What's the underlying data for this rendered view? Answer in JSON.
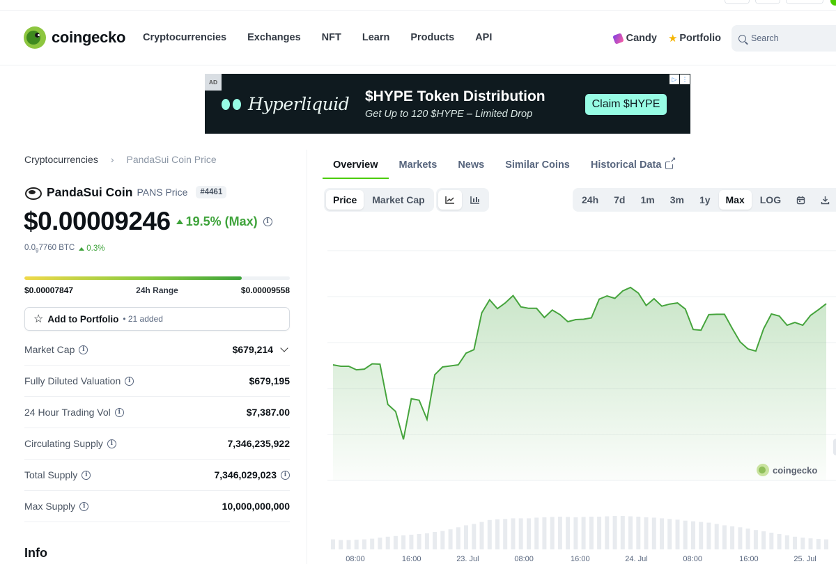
{
  "header": {
    "logo_text": "coingecko",
    "nav": [
      "Cryptocurrencies",
      "Exchanges",
      "NFT",
      "Learn",
      "Products",
      "API"
    ],
    "candy_label": "Candy",
    "portfolio_label": "Portfolio",
    "search_placeholder": "Search"
  },
  "ad": {
    "tag": "AD",
    "brand": "Hyperliquid",
    "headline": "$HYPE Token Distribution",
    "subline": "Get Up to 120 $HYPE – Limited Drop",
    "cta": "Claim $HYPE"
  },
  "breadcrumb": {
    "root": "Cryptocurrencies",
    "current": "PandaSui Coin Price"
  },
  "coin": {
    "name": "PandaSui Coin",
    "symbol_price": "PANS Price",
    "rank": "#4461",
    "price": "$0.00009246",
    "change": "19.5% (Max)",
    "btc_price": "0.0",
    "btc_sub": "9",
    "btc_tail": "7760 BTC",
    "btc_change": "0.3%"
  },
  "range": {
    "low": "$0.00007847",
    "label": "24h Range",
    "high": "$0.00009558",
    "position_pct": 82
  },
  "portfolio_btn": {
    "label": "Add to Portfolio",
    "count": "• 21 added"
  },
  "stats": [
    {
      "label": "Market Cap",
      "value": "$679,214"
    },
    {
      "label": "Fully Diluted Valuation",
      "value": "$679,195"
    },
    {
      "label": "24 Hour Trading Vol",
      "value": "$7,387.00"
    },
    {
      "label": "Circulating Supply",
      "value": "7,346,235,922"
    },
    {
      "label": "Total Supply",
      "value": "7,346,029,023"
    },
    {
      "label": "Max Supply",
      "value": "10,000,000,000"
    }
  ],
  "info_heading": "Info",
  "tabs": [
    "Overview",
    "Markets",
    "News",
    "Similar Coins",
    "Historical Data"
  ],
  "chart_controls": {
    "metric": [
      "Price",
      "Market Cap"
    ],
    "ranges": [
      "24h",
      "7d",
      "1m",
      "3m",
      "1y",
      "Max",
      "LOG"
    ]
  },
  "chart_watermark": "coingecko",
  "colors": {
    "accent": "#4bcc00",
    "up": "#3ea33a",
    "line": "#46a43d"
  },
  "chart_data": {
    "type": "area",
    "x_ticks": [
      "08:00",
      "16:00",
      "23. Jul",
      "08:00",
      "16:00",
      "24. Jul",
      "08:00",
      "16:00",
      "25. Jul"
    ],
    "series": [
      {
        "values": [
          8.27,
          8.23,
          8.23,
          8.13,
          8.15,
          8.3,
          8.29,
          7.15,
          6.95,
          6.16,
          7.31,
          7.27,
          6.73,
          7.99,
          8.21,
          8.24,
          8.27,
          8.6,
          8.7,
          9.74,
          10.11,
          9.86,
          10.02,
          10.23,
          9.91,
          9.87,
          9.87,
          9.61,
          9.82,
          9.69,
          9.49,
          9.55,
          9.56,
          9.6,
          10.13,
          10.22,
          10.15,
          10.36,
          10.46,
          10.3,
          9.95,
          10.14,
          9.93,
          9.99,
          10.02,
          9.85,
          9.27,
          9.25,
          9.69,
          9.7,
          9.7,
          9.3,
          8.92,
          8.72,
          8.66,
          9.29,
          9.71,
          9.65,
          9.39,
          9.47,
          9.39,
          9.67,
          9.83,
          10.0
        ]
      }
    ],
    "volume": [
      0.3,
      0.28,
      0.28,
      0.29,
      0.3,
      0.32,
      0.35,
      0.38,
      0.4,
      0.42,
      0.44,
      0.46,
      0.48,
      0.52,
      0.55,
      0.6,
      0.66,
      0.72,
      0.76,
      0.82,
      0.88,
      0.9,
      0.91,
      0.93,
      0.93,
      0.93,
      0.95,
      0.96,
      0.97,
      0.98,
      0.97,
      0.96,
      0.97,
      0.98,
      0.98,
      0.99,
      1.0,
      1.0,
      0.99,
      0.98,
      0.96,
      0.95,
      0.93,
      0.91,
      0.89,
      0.86,
      0.84,
      0.82,
      0.8,
      0.76,
      0.72,
      0.69,
      0.66,
      0.62,
      0.58,
      0.54,
      0.5,
      0.46,
      0.42,
      0.38,
      0.35,
      0.33,
      0.31,
      0.3
    ],
    "ylim": [
      5.0,
      11.5
    ],
    "grid": true,
    "legend": "none"
  }
}
